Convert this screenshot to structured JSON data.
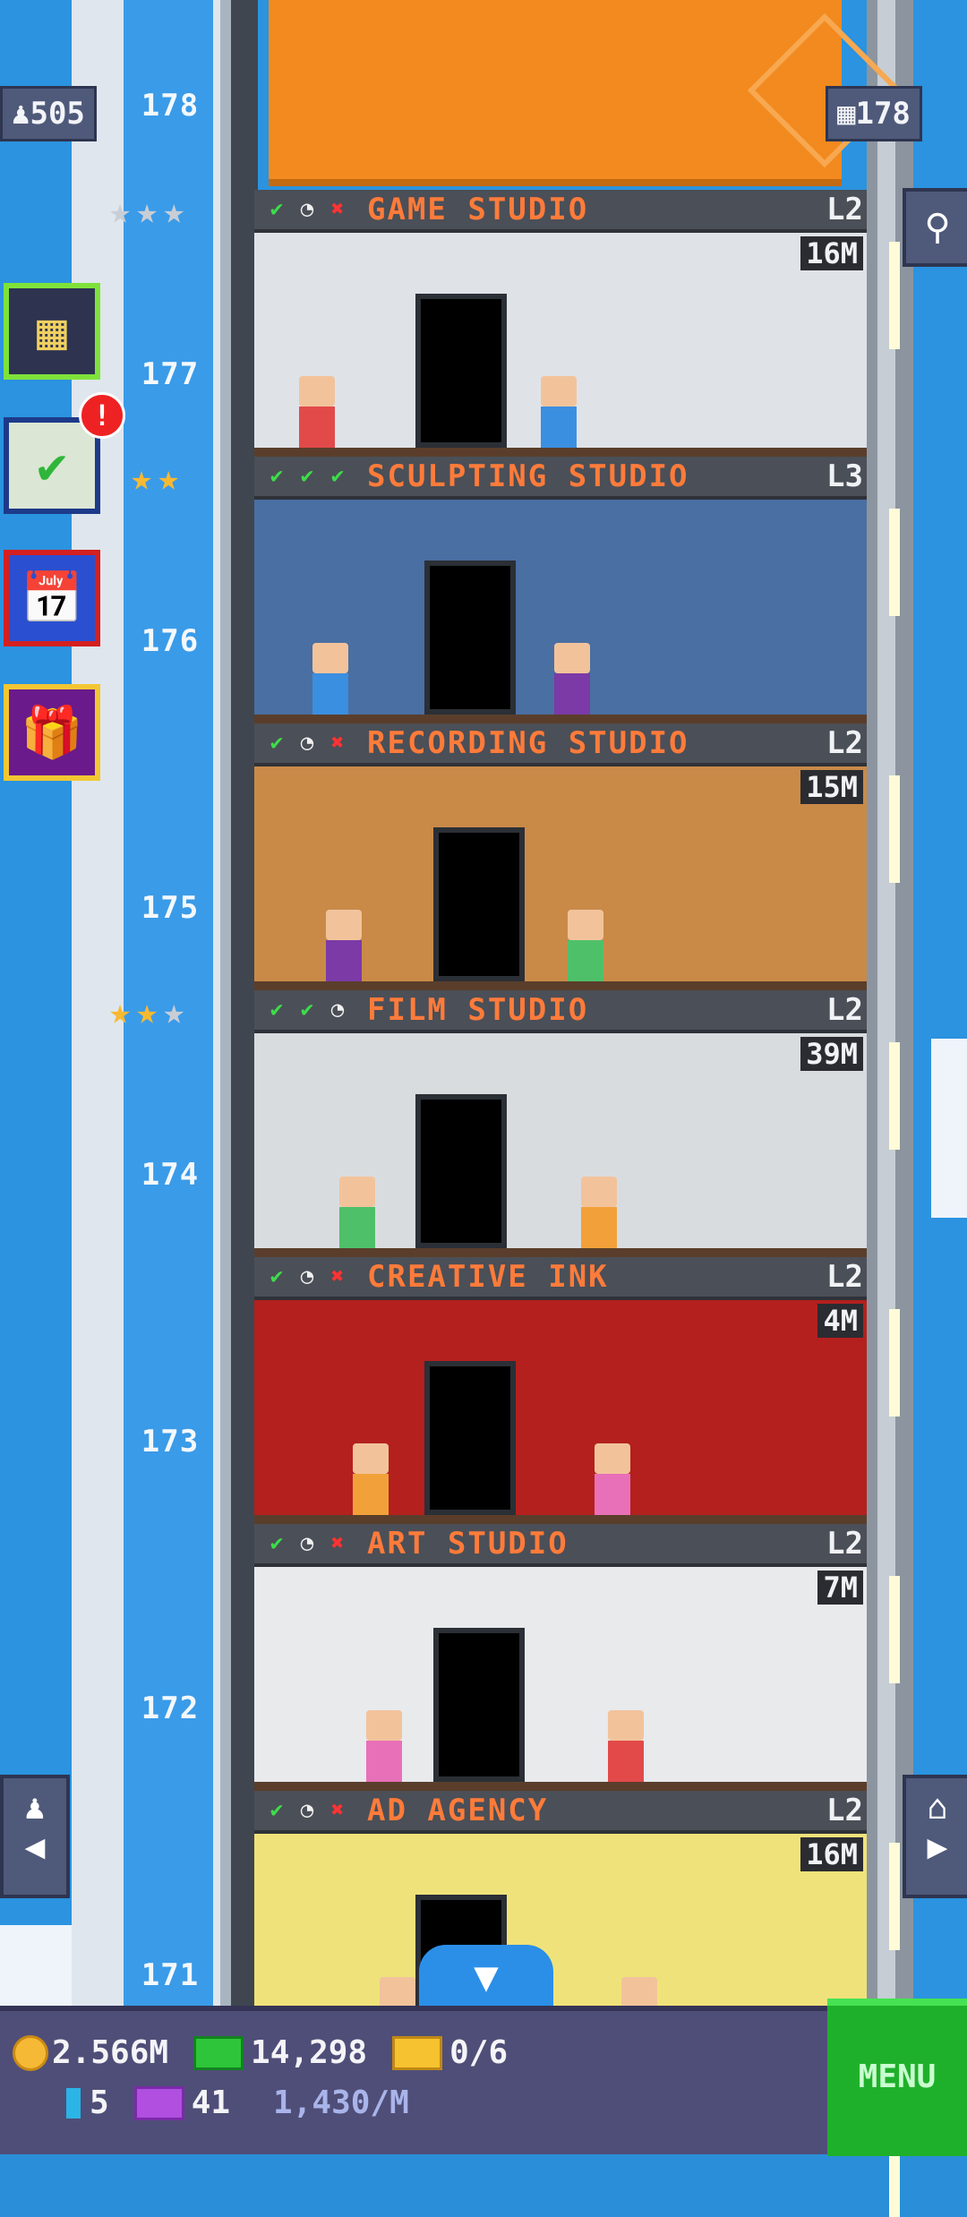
{
  "top_badges": {
    "population": "505",
    "floors": "178"
  },
  "construction_floor": "178",
  "floors": [
    {
      "number": "177",
      "name": "GAME STUDIO",
      "level": "L2",
      "value": "16M",
      "status": [
        "ok",
        "clock",
        "x"
      ],
      "stars": 3,
      "stars_filled": 0
    },
    {
      "number": "176",
      "name": "SCULPTING STUDIO",
      "level": "L3",
      "value": "",
      "status": [
        "ok",
        "ok",
        "ok"
      ],
      "stars": 2,
      "stars_filled": 2
    },
    {
      "number": "175",
      "name": "RECORDING STUDIO",
      "level": "L2",
      "value": "15M",
      "status": [
        "ok",
        "clock",
        "x"
      ],
      "stars": 0,
      "stars_filled": 0
    },
    {
      "number": "174",
      "name": "FILM STUDIO",
      "level": "L2",
      "value": "39M",
      "status": [
        "ok",
        "ok",
        "clock"
      ],
      "stars": 3,
      "stars_filled": 2
    },
    {
      "number": "173",
      "name": "CREATIVE INK",
      "level": "L2",
      "value": "4M",
      "status": [
        "ok",
        "clock",
        "x"
      ],
      "stars": 0,
      "stars_filled": 0
    },
    {
      "number": "172",
      "name": "ART STUDIO",
      "level": "L2",
      "value": "7M",
      "status": [
        "ok",
        "clock",
        "x"
      ],
      "stars": 0,
      "stars_filled": 0
    },
    {
      "number": "171",
      "name": "AD AGENCY",
      "level": "L2",
      "value": "16M",
      "status": [
        "ok",
        "clock",
        "x"
      ],
      "stars": 0,
      "stars_filled": 0
    }
  ],
  "side_buttons": [
    "building-icon",
    "checklist-icon",
    "calendar-icon",
    "gift-icon"
  ],
  "notification": "!",
  "bottom_bar": {
    "coins": "2.566M",
    "bux": "14,298",
    "tickets": "0/6",
    "gems": "5",
    "vip_tickets": "41",
    "rate": "1,430/M",
    "menu_label": "MENU"
  },
  "colors": {
    "floor_name": "#ff7b3a",
    "sky": "#2b93df",
    "menu": "#1fb02b"
  }
}
